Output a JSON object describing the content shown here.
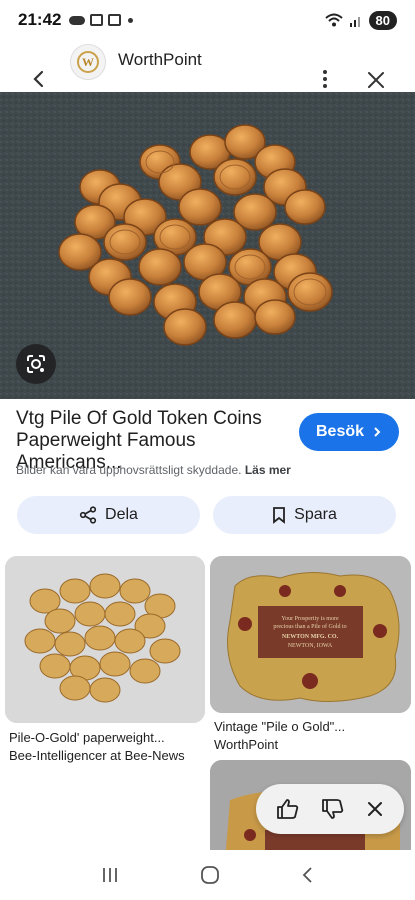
{
  "status_bar": {
    "time": "21:42",
    "battery": "80"
  },
  "header": {
    "site_name": "WorthPoint",
    "logo_letter": "W"
  },
  "result": {
    "title": "Vtg Pile Of Gold Token Coins Paperweight Famous Americans...",
    "visit_label": "Besök",
    "copyright_text": "Bilder kan vara upphovsrättsligt skyddade.",
    "learn_more": "Läs mer"
  },
  "actions": {
    "share_label": "Dela",
    "save_label": "Spara"
  },
  "related": [
    {
      "title": "Pile-O-Gold' paperweight...",
      "source": "Bee-Intelligencer at Bee-News"
    },
    {
      "title": "Vintage \"Pile o Gold\"...",
      "source": "WorthPoint"
    }
  ],
  "plaque": {
    "line1": "Your Prosperity is more",
    "line2": "precious than a Pile of Gold to",
    "line3": "NEWTON MFG. CO.",
    "line4": "NEWTON, IOWA"
  },
  "colors": {
    "accent": "#1a73e8",
    "chip_bg": "#e8eefb",
    "gold": "#c98a3a"
  }
}
